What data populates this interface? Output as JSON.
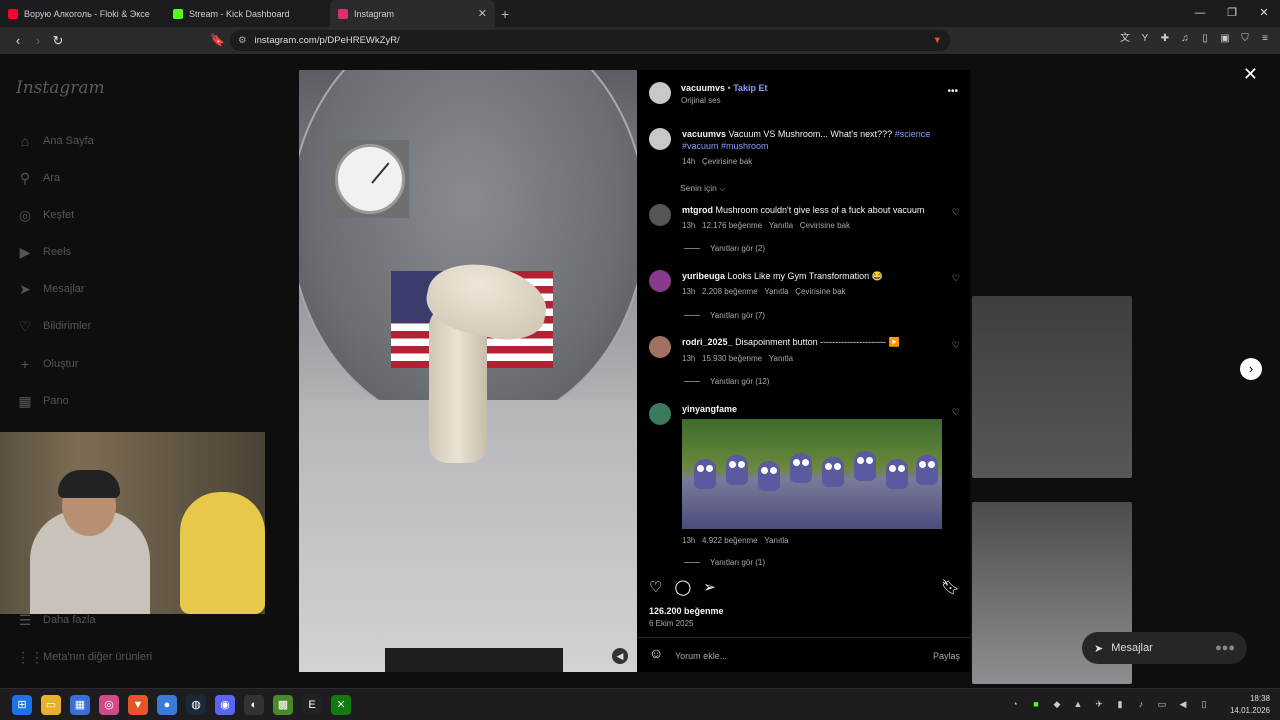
{
  "browser": {
    "tabs": [
      {
        "label": "Ворую Алкоголь - Floki & Эксе",
        "favicon_color": "#ff0033",
        "active": false
      },
      {
        "label": "Stream - Kick Dashboard",
        "favicon_color": "#53fc18",
        "active": false
      },
      {
        "label": "Instagram",
        "favicon_color": "#e1306c",
        "active": true
      }
    ],
    "new_tab": "+",
    "url": "instagram.com/p/DPeHREWkZyR/"
  },
  "sidebar": {
    "logo": "Instagram",
    "items": [
      {
        "label": "Ana Sayfa",
        "icon": "home-icon",
        "glyph": "⌂"
      },
      {
        "label": "Ara",
        "icon": "search-icon",
        "glyph": "⚲"
      },
      {
        "label": "Keşfet",
        "icon": "compass-icon",
        "glyph": "◎"
      },
      {
        "label": "Reels",
        "icon": "reels-icon",
        "glyph": "▶"
      },
      {
        "label": "Mesajlar",
        "icon": "send-icon",
        "glyph": "➤"
      },
      {
        "label": "Bildirimler",
        "icon": "heart-icon",
        "glyph": "♡"
      },
      {
        "label": "Oluştur",
        "icon": "plus-icon",
        "glyph": "+"
      },
      {
        "label": "Pano",
        "icon": "dashboard-icon",
        "glyph": "▦"
      },
      {
        "label": "Daha fazla",
        "icon": "menu-icon",
        "glyph": "☰"
      },
      {
        "label": "Meta'nın diğer ürünleri",
        "icon": "grid-icon",
        "glyph": "⋮⋮"
      }
    ]
  },
  "post": {
    "username": "vacuumvs",
    "follow_label": "Takip Et",
    "separator": "•",
    "audio": "Orijinal ses",
    "more": "•••",
    "caption_user": "vacuumvs",
    "caption_text": "Vacuum VS Mushroom... What's next???",
    "caption_tags_1": "#science",
    "caption_tags_2": "#vacuum #mushroom",
    "caption_time": "14h",
    "caption_translate": "Çevirisine bak",
    "sort_label": "Senin için ⌵",
    "likes": "126.200 beğenme",
    "date": "6 Ekim 2025",
    "comment_placeholder": "Yorum ekle...",
    "share_label": "Paylaş"
  },
  "comments": [
    {
      "user": "mtgrod",
      "text": "Mushroom couldn't give less of a fuck about vacuum",
      "time": "13h",
      "likes": "12.176 beğenme",
      "reply": "Yanıtla",
      "translate": "Çevirisine bak",
      "replies": "Yanıtları gör (2)"
    },
    {
      "user": "yuribeuga",
      "text": "Looks Like my Gym Transformation 😂",
      "time": "13h",
      "likes": "2.208 beğenme",
      "reply": "Yanıtla",
      "translate": "Çevirisine bak",
      "replies": "Yanıtları gör (7)"
    },
    {
      "user": "rodri_2025_",
      "text": "Disapoinment button ---------------------- ▶️",
      "time": "13h",
      "likes": "15.930 beğenme",
      "reply": "Yanıtla",
      "translate": "",
      "replies": "Yanıtları gör (12)"
    },
    {
      "user": "yinyangfame",
      "text": "",
      "time": "13h",
      "likes": "4.922 beğenme",
      "reply": "Yanıtla",
      "translate": "",
      "replies": "Yanıtları gör (1)"
    }
  ],
  "floating": {
    "messages_label": "Mesajlar"
  },
  "taskbar": {
    "time": "18:38",
    "date": "14.01.2026"
  },
  "colors": {
    "link_blue": "#8a9cff",
    "bg": "#0e0e0e"
  }
}
